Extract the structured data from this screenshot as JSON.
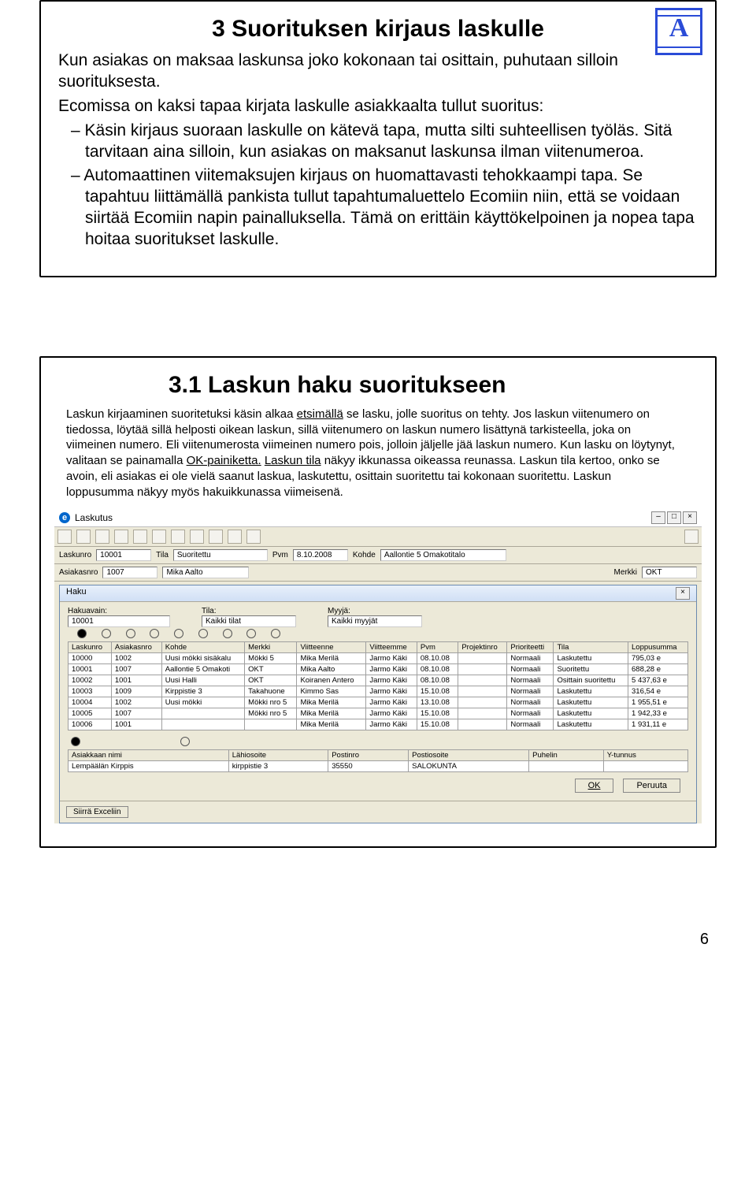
{
  "page_number": "6",
  "logo_letter": "A",
  "slide1": {
    "title": "3 Suorituksen kirjaus laskulle",
    "intro1": "Kun asiakas on maksaa laskunsa joko kokonaan tai osittain, puhutaan silloin suorituksesta.",
    "intro2": "Ecomissa on kaksi tapaa kirjata laskulle asiakkaalta tullut suoritus:",
    "bullet1": "Käsin kirjaus suoraan laskulle on kätevä tapa, mutta silti suhteellisen työläs. Sitä tarvitaan aina silloin, kun asiakas on maksanut laskunsa ilman viitenumeroa.",
    "bullet2": "Automaattinen viitemaksujen kirjaus on huomattavasti tehokkaampi tapa. Se tapahtuu liittämällä pankista tullut tapahtumaluettelo Ecomiin niin, että se voidaan siirtää Ecomiin napin painalluksella. Tämä on erittäin käyttökelpoinen ja nopea tapa hoitaa suoritukset laskulle."
  },
  "slide2": {
    "title": "3.1 Laskun haku suoritukseen",
    "para_a": "Laskun kirjaaminen suoritetuksi käsin alkaa ",
    "u_etsimalla": "etsimällä",
    "para_b": " se lasku, jolle suoritus on tehty. Jos laskun viitenumero on tiedossa, löytää sillä helposti oikean laskun, sillä viitenumero on laskun numero lisättynä tarkisteella, joka on viimeinen numero. Eli viitenumerosta viimeinen numero pois, jolloin jäljelle jää laskun numero. Kun lasku on löytynyt, valitaan se painamalla ",
    "u_okpainiketta": "OK-painiketta.",
    "para_c": " ",
    "u_laskuntila": "Laskun tila",
    "para_d": " näkyy ikkunassa oikeassa reunassa. Laskun tila kertoo, onko se avoin, eli asiakas ei ole vielä saanut laskua, laskutettu, osittain suoritettu tai kokonaan suoritettu. Laskun loppusumma näkyy myös hakuikkunassa viimeisenä."
  },
  "laskutus": {
    "window_title": "Laskutus",
    "lasku_lbl": "Laskunro",
    "lasku_val": "10001",
    "tila_lbl": "Tila",
    "tila_val": "Suoritettu",
    "pvm_lbl": "Pvm",
    "pvm_val": "8.10.2008",
    "kohde_lbl": "Kohde",
    "kohde_val": "Aallontie 5 Omakotitalo",
    "asiakas_lbl": "Asiakasnro",
    "asiakas_val": "1007",
    "asiakas_name": "Mika Aalto",
    "merkki_lbl": "Merkki",
    "merkki_val": "OKT"
  },
  "haku": {
    "title": "Haku",
    "hakuavain_lbl": "Hakuavain:",
    "hakuavain_val": "10001",
    "tila_lbl": "Tila:",
    "tila_val": "Kaikki tilat",
    "myyja_lbl": "Myyjä:",
    "myyja_val": "Kaikki myyjät",
    "headers": [
      "Laskunro",
      "Asiakasnro",
      "Kohde",
      "Merkki",
      "Viitteenne",
      "Viitteemme",
      "Pvm",
      "Projektinro",
      "Prioriteetti",
      "Tila",
      "Loppusumma"
    ],
    "rows": [
      [
        "10000",
        "1002",
        "Uusi mökki sisäkalu",
        "Mökki 5",
        "Mika Merilä",
        "Jarmo Käki",
        "08.10.08",
        "",
        "Normaali",
        "Laskutettu",
        "795,03 e"
      ],
      [
        "10001",
        "1007",
        "Aallontie 5 Omakoti",
        "OKT",
        "Mika Aalto",
        "Jarmo Käki",
        "08.10.08",
        "",
        "Normaali",
        "Suoritettu",
        "688,28 e"
      ],
      [
        "10002",
        "1001",
        "Uusi Halli",
        "OKT",
        "Koiranen Antero",
        "Jarmo Käki",
        "08.10.08",
        "",
        "Normaali",
        "Osittain suoritettu",
        "5 437,63 e"
      ],
      [
        "10003",
        "1009",
        "Kirppistie 3",
        "Takahuone",
        "Kimmo Sas",
        "Jarmo Käki",
        "15.10.08",
        "",
        "Normaali",
        "Laskutettu",
        "316,54 e"
      ],
      [
        "10004",
        "1002",
        "Uusi mökki",
        "Mökki nro 5",
        "Mika Merilä",
        "Jarmo Käki",
        "13.10.08",
        "",
        "Normaali",
        "Laskutettu",
        "1 955,51 e"
      ],
      [
        "10005",
        "1007",
        "",
        "Mökki nro 5",
        "Mika Merilä",
        "Jarmo Käki",
        "15.10.08",
        "",
        "Normaali",
        "Laskutettu",
        "1 942,33 e"
      ],
      [
        "10006",
        "1001",
        "",
        "",
        "Mika Merilä",
        "Jarmo Käki",
        "15.10.08",
        "",
        "Normaali",
        "Laskutettu",
        "1 931,11 e"
      ]
    ],
    "cust_headers": [
      "Asiakkaan nimi",
      "Lähiosoite",
      "Postinro",
      "Postiosoite",
      "Puhelin",
      "Y-tunnus"
    ],
    "cust_row": [
      "Lempäälän Kirppis",
      "kirppistie 3",
      "35550",
      "SALOKUNTA",
      "",
      ""
    ],
    "siira": "Siirrä Exceliin",
    "ok": "OK",
    "peruuta": "Peruuta"
  }
}
